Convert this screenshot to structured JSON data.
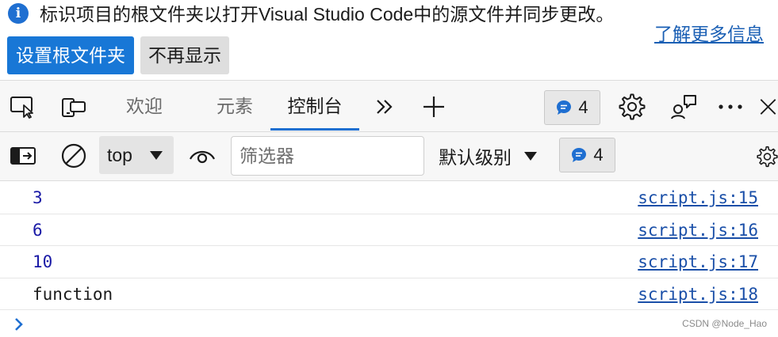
{
  "banner": {
    "message": "标识项目的根文件夹以打开Visual Studio Code中的源文件并同步更改。",
    "learn_more": "了解更多信息",
    "set_root_button": "设置根文件夹",
    "dont_show_button": "不再显示"
  },
  "tabs": [
    {
      "label": "欢迎"
    },
    {
      "label": "元素"
    },
    {
      "label": "控制台"
    }
  ],
  "active_tab": "控制台",
  "issues_count": "4",
  "console_toolbar": {
    "context": "top",
    "filter_placeholder": "筛选器",
    "level": "默认级别",
    "issues_count": "4"
  },
  "log": [
    {
      "value": "3",
      "kind": "number",
      "source": "script.js:15"
    },
    {
      "value": "6",
      "kind": "number",
      "source": "script.js:16"
    },
    {
      "value": "10",
      "kind": "number",
      "source": "script.js:17"
    },
    {
      "value": "function",
      "kind": "string",
      "source": "script.js:18"
    }
  ],
  "watermark": "CSDN @Node_Hao",
  "colors": {
    "accent": "#1f6fd1",
    "primary_button": "#1877d6",
    "link": "#1a4fa8",
    "number_value": "#1a1aa6"
  },
  "icons": [
    "info-icon",
    "inspect-icon",
    "device-emulation-icon",
    "more-tabs-icon",
    "add-tab-icon",
    "issues-bubble-icon",
    "settings-gear-icon",
    "feedback-icon",
    "more-options-icon",
    "close-icon",
    "sidebar-toggle-icon",
    "clear-console-icon",
    "live-expression-eye-icon",
    "console-settings-icon",
    "prompt-chevron-icon"
  ]
}
